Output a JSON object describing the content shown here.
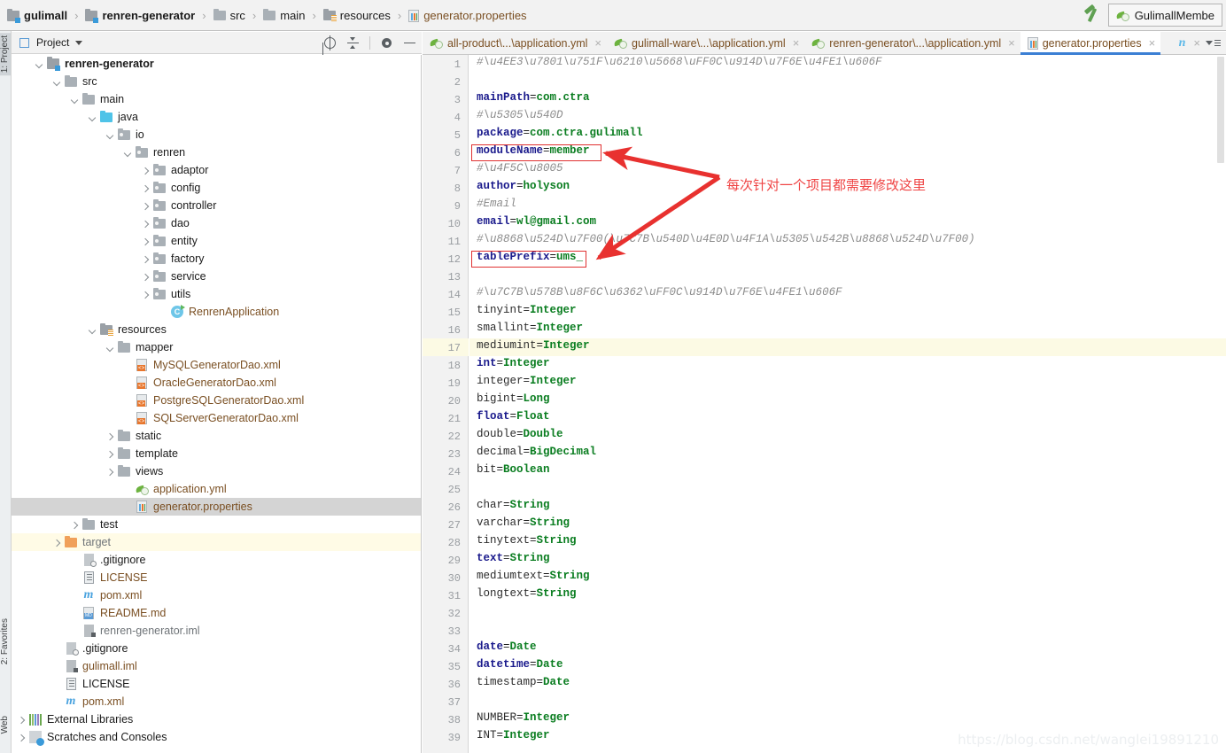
{
  "window": {
    "breadcrumbs": [
      {
        "label": "gulimall",
        "icon": "module-icon",
        "style": "bold"
      },
      {
        "label": "renren-generator",
        "icon": "module-icon",
        "style": "bold"
      },
      {
        "label": "src",
        "icon": "folder-icon",
        "style": "normal"
      },
      {
        "label": "main",
        "icon": "folder-icon",
        "style": "normal"
      },
      {
        "label": "resources",
        "icon": "resources-folder-icon",
        "style": "normal"
      },
      {
        "label": "generator.properties",
        "icon": "properties-file-icon",
        "style": "orange"
      }
    ],
    "separator": "›",
    "run_config": {
      "label": "GulimallMembe",
      "icon": "spring-boot-icon"
    },
    "build_icon": "hammer-icon"
  },
  "left_strips": {
    "top": "1: Project",
    "bottom": [
      "2: Favorites",
      "Web"
    ]
  },
  "project_panel": {
    "title": "Project",
    "dropdown_caret": "chevron-down-icon",
    "header_icons": [
      "locate-target-icon",
      "collapse-all-icon",
      "settings-gear-icon",
      "hide-icon"
    ],
    "tree": [
      {
        "label": "renren-generator",
        "depth": 1,
        "arrow": "down",
        "icon": "module-icon",
        "style": "bold"
      },
      {
        "label": "src",
        "depth": 2,
        "arrow": "down",
        "icon": "folder-icon",
        "style": "normal"
      },
      {
        "label": "main",
        "depth": 3,
        "arrow": "down",
        "icon": "folder-icon",
        "style": "normal"
      },
      {
        "label": "java",
        "depth": 4,
        "arrow": "down",
        "icon": "source-folder-icon",
        "style": "normal"
      },
      {
        "label": "io",
        "depth": 5,
        "arrow": "down",
        "icon": "package-icon",
        "style": "normal"
      },
      {
        "label": "renren",
        "depth": 6,
        "arrow": "down",
        "icon": "package-icon",
        "style": "normal"
      },
      {
        "label": "adaptor",
        "depth": 7,
        "arrow": "right",
        "icon": "package-icon",
        "style": "normal"
      },
      {
        "label": "config",
        "depth": 7,
        "arrow": "right",
        "icon": "package-icon",
        "style": "normal"
      },
      {
        "label": "controller",
        "depth": 7,
        "arrow": "right",
        "icon": "package-icon",
        "style": "normal"
      },
      {
        "label": "dao",
        "depth": 7,
        "arrow": "right",
        "icon": "package-icon",
        "style": "normal"
      },
      {
        "label": "entity",
        "depth": 7,
        "arrow": "right",
        "icon": "package-icon",
        "style": "normal"
      },
      {
        "label": "factory",
        "depth": 7,
        "arrow": "right",
        "icon": "package-icon",
        "style": "normal"
      },
      {
        "label": "service",
        "depth": 7,
        "arrow": "right",
        "icon": "package-icon",
        "style": "normal"
      },
      {
        "label": "utils",
        "depth": 7,
        "arrow": "right",
        "icon": "package-icon",
        "style": "normal"
      },
      {
        "label": "RenrenApplication",
        "depth": 8,
        "arrow": "none",
        "icon": "java-class-run-icon",
        "style": "brown"
      },
      {
        "label": "resources",
        "depth": 4,
        "arrow": "down",
        "icon": "resources-folder-icon",
        "style": "normal"
      },
      {
        "label": "mapper",
        "depth": 5,
        "arrow": "down",
        "icon": "folder-icon",
        "style": "normal"
      },
      {
        "label": "MySQLGeneratorDao.xml",
        "depth": 6,
        "arrow": "none",
        "icon": "xml-file-icon",
        "style": "brown"
      },
      {
        "label": "OracleGeneratorDao.xml",
        "depth": 6,
        "arrow": "none",
        "icon": "xml-file-icon",
        "style": "brown"
      },
      {
        "label": "PostgreSQLGeneratorDao.xml",
        "depth": 6,
        "arrow": "none",
        "icon": "xml-file-icon",
        "style": "brown"
      },
      {
        "label": "SQLServerGeneratorDao.xml",
        "depth": 6,
        "arrow": "none",
        "icon": "xml-file-icon",
        "style": "brown"
      },
      {
        "label": "static",
        "depth": 5,
        "arrow": "right",
        "icon": "folder-icon",
        "style": "normal"
      },
      {
        "label": "template",
        "depth": 5,
        "arrow": "right",
        "icon": "folder-icon",
        "style": "normal"
      },
      {
        "label": "views",
        "depth": 5,
        "arrow": "right",
        "icon": "folder-icon",
        "style": "normal"
      },
      {
        "label": "application.yml",
        "depth": 6,
        "arrow": "none",
        "icon": "spring-yml-icon",
        "style": "brown"
      },
      {
        "label": "generator.properties",
        "depth": 6,
        "arrow": "none",
        "icon": "properties-file-icon",
        "style": "brown",
        "state": "selected"
      },
      {
        "label": "test",
        "depth": 3,
        "arrow": "right",
        "icon": "folder-icon",
        "style": "normal"
      },
      {
        "label": "target",
        "depth": 2,
        "arrow": "right",
        "icon": "excluded-folder-icon",
        "style": "gray",
        "state": "highlighted"
      },
      {
        "label": ".gitignore",
        "depth": 3,
        "arrow": "none",
        "icon": "gitignore-file-icon",
        "style": "normal"
      },
      {
        "label": "LICENSE",
        "depth": 3,
        "arrow": "none",
        "icon": "license-file-icon",
        "style": "brown"
      },
      {
        "label": "pom.xml",
        "depth": 3,
        "arrow": "none",
        "icon": "maven-pom-icon",
        "style": "brown"
      },
      {
        "label": "README.md",
        "depth": 3,
        "arrow": "none",
        "icon": "markdown-file-icon",
        "style": "brown"
      },
      {
        "label": "renren-generator.iml",
        "depth": 3,
        "arrow": "none",
        "icon": "iml-file-icon",
        "style": "gray"
      },
      {
        "label": ".gitignore",
        "depth": 2,
        "arrow": "none",
        "icon": "gitignore-file-icon",
        "style": "normal"
      },
      {
        "label": "gulimall.iml",
        "depth": 2,
        "arrow": "none",
        "icon": "iml-file-icon",
        "style": "brown"
      },
      {
        "label": "LICENSE",
        "depth": 2,
        "arrow": "none",
        "icon": "license-file-icon",
        "style": "normal"
      },
      {
        "label": "pom.xml",
        "depth": 2,
        "arrow": "none",
        "icon": "maven-pom-icon",
        "style": "brown"
      },
      {
        "label": "External Libraries",
        "depth": 0,
        "arrow": "right",
        "icon": "external-libraries-icon",
        "style": "normal"
      },
      {
        "label": "Scratches and Consoles",
        "depth": 0,
        "arrow": "right",
        "icon": "scratches-icon",
        "style": "normal"
      }
    ]
  },
  "editor_tabs": [
    {
      "label": "all-product\\...\\application.yml",
      "icon": "spring-yml-icon",
      "active": false,
      "close": "×"
    },
    {
      "label": "gulimall-ware\\...\\application.yml",
      "icon": "spring-yml-icon",
      "active": false,
      "close": "×"
    },
    {
      "label": "renren-generator\\...\\application.yml",
      "icon": "spring-yml-icon",
      "active": false,
      "close": "×"
    },
    {
      "label": "generator.properties",
      "icon": "properties-file-icon",
      "active": true,
      "close": "×"
    },
    {
      "label": "n",
      "icon": "nginx-file-icon",
      "active": false,
      "close": "×"
    }
  ],
  "editor": {
    "filename": "generator.properties",
    "caret_line": 17,
    "lines": [
      {
        "n": 1,
        "type": "comment",
        "text": "#\\u4EE3\\u7801\\u751F\\u6210\\u5668\\uFF0C\\u914D\\u7F6E\\u4FE1\\u606F"
      },
      {
        "n": 2,
        "type": "blank",
        "text": ""
      },
      {
        "n": 3,
        "type": "kv",
        "key": "mainPath",
        "value": "com.ctra",
        "bold_key": true
      },
      {
        "n": 4,
        "type": "comment",
        "text": "#\\u5305\\u540D"
      },
      {
        "n": 5,
        "type": "kv",
        "key": "package",
        "value": "com.ctra.gulimall",
        "bold_key": true
      },
      {
        "n": 6,
        "type": "kv",
        "key": "moduleName",
        "value": "member",
        "bold_key": true,
        "boxed": true
      },
      {
        "n": 7,
        "type": "comment",
        "text": "#\\u4F5C\\u8005"
      },
      {
        "n": 8,
        "type": "kv",
        "key": "author",
        "value": "holyson",
        "bold_key": true
      },
      {
        "n": 9,
        "type": "comment",
        "text": "#Email"
      },
      {
        "n": 10,
        "type": "kv",
        "key": "email",
        "value": "wl@gmail.com",
        "bold_key": true
      },
      {
        "n": 11,
        "type": "comment",
        "text": "#\\u8868\\u524D\\u7F00(\\u7C7B\\u540D\\u4E0D\\u4F1A\\u5305\\u542B\\u8868\\u524D\\u7F00)"
      },
      {
        "n": 12,
        "type": "kv",
        "key": "tablePrefix",
        "value": "ums_",
        "bold_key": true,
        "boxed": true
      },
      {
        "n": 13,
        "type": "blank",
        "text": ""
      },
      {
        "n": 14,
        "type": "comment",
        "text": "#\\u7C7B\\u578B\\u8F6C\\u6362\\uFF0C\\u914D\\u7F6E\\u4FE1\\u606F"
      },
      {
        "n": 15,
        "type": "kv",
        "key": "tinyint",
        "value": "Integer",
        "bold_key": false
      },
      {
        "n": 16,
        "type": "kv",
        "key": "smallint",
        "value": "Integer",
        "bold_key": false
      },
      {
        "n": 17,
        "type": "kv",
        "key": "mediumint",
        "value": "Integer",
        "bold_key": false
      },
      {
        "n": 18,
        "type": "kv",
        "key": "int",
        "value": "Integer",
        "bold_key": true
      },
      {
        "n": 19,
        "type": "kv",
        "key": "integer",
        "value": "Integer",
        "bold_key": false
      },
      {
        "n": 20,
        "type": "kv",
        "key": "bigint",
        "value": "Long",
        "bold_key": false
      },
      {
        "n": 21,
        "type": "kv",
        "key": "float",
        "value": "Float",
        "bold_key": true
      },
      {
        "n": 22,
        "type": "kv",
        "key": "double",
        "value": "Double",
        "bold_key": false
      },
      {
        "n": 23,
        "type": "kv",
        "key": "decimal",
        "value": "BigDecimal",
        "bold_key": false
      },
      {
        "n": 24,
        "type": "kv",
        "key": "bit",
        "value": "Boolean",
        "bold_key": false
      },
      {
        "n": 25,
        "type": "blank",
        "text": ""
      },
      {
        "n": 26,
        "type": "kv",
        "key": "char",
        "value": "String",
        "bold_key": false
      },
      {
        "n": 27,
        "type": "kv",
        "key": "varchar",
        "value": "String",
        "bold_key": false
      },
      {
        "n": 28,
        "type": "kv",
        "key": "tinytext",
        "value": "String",
        "bold_key": false
      },
      {
        "n": 29,
        "type": "kv",
        "key": "text",
        "value": "String",
        "bold_key": true
      },
      {
        "n": 30,
        "type": "kv",
        "key": "mediumtext",
        "value": "String",
        "bold_key": false
      },
      {
        "n": 31,
        "type": "kv",
        "key": "longtext",
        "value": "String",
        "bold_key": false
      },
      {
        "n": 32,
        "type": "blank",
        "text": ""
      },
      {
        "n": 33,
        "type": "blank",
        "text": ""
      },
      {
        "n": 34,
        "type": "kv",
        "key": "date",
        "value": "Date",
        "bold_key": true
      },
      {
        "n": 35,
        "type": "kv",
        "key": "datetime",
        "value": "Date",
        "bold_key": true
      },
      {
        "n": 36,
        "type": "kv",
        "key": "timestamp",
        "value": "Date",
        "bold_key": false
      },
      {
        "n": 37,
        "type": "blank",
        "text": ""
      },
      {
        "n": 38,
        "type": "kv",
        "key": "NUMBER",
        "value": "Integer",
        "bold_key": false
      },
      {
        "n": 39,
        "type": "kv",
        "key": "INT",
        "value": "Integer",
        "bold_key": false
      }
    ]
  },
  "annotation": {
    "text": "每次针对一个项目都需要修改这里",
    "color": "#ef4444"
  },
  "watermark": {
    "text": "https://blog.csdn.net/wanglei19891210"
  },
  "colors": {
    "accent": "#3b7fd4",
    "annotation_red": "#e03131",
    "keyword_blue": "#1a1a8c",
    "value_green": "#0a7d20",
    "comment_gray": "#8c8c8c",
    "selection_gray": "#d4d4d4",
    "caret_line_yellow": "#fcfae4"
  }
}
